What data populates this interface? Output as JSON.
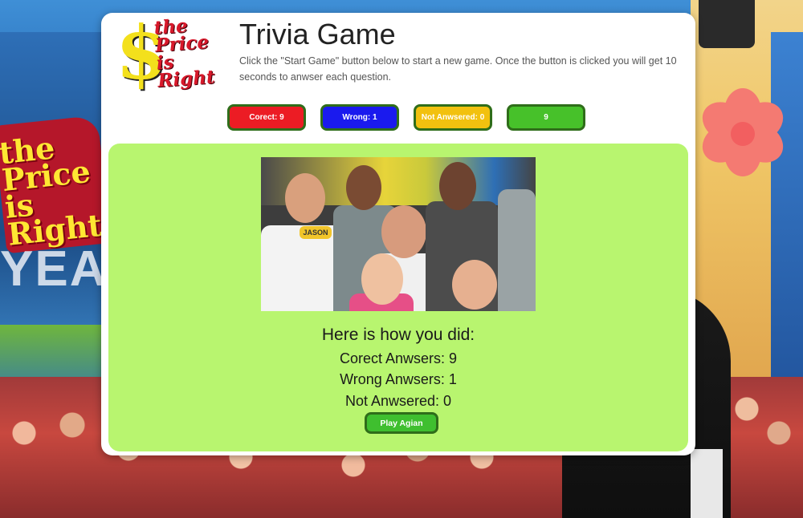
{
  "background": {
    "logo_text": [
      "the",
      "Price",
      "is",
      "Right"
    ],
    "year_text": "YEA"
  },
  "header": {
    "logo": {
      "symbol": "$",
      "words": [
        "the",
        "Price",
        "is",
        "Right"
      ]
    },
    "title": "Trivia Game",
    "description": "Click the \"Start Game\" button below to start a new game. Once the button is clicked you will get 10 seconds to anwser each question."
  },
  "stats": [
    {
      "label": "Corect: 9",
      "color": "#ec1c24"
    },
    {
      "label": "Wrong: 1",
      "color": "#1a1aee"
    },
    {
      "label": "Not Anwsered: 0",
      "color": "#f2c10f"
    },
    {
      "label": "9",
      "color": "#47c12a"
    }
  ],
  "result": {
    "heading": "Here is how you did:",
    "correct": "Corect Anwsers: 9",
    "wrong": "Wrong Anwsers: 1",
    "unanswered": "Not Anwsered: 0",
    "play_again_label": "Play Agian"
  },
  "photo": {
    "badge_text": "JASON"
  },
  "colors": {
    "panel_bg": "#b8f56f",
    "button_border": "#2f6d1a",
    "play_button": "#3fbf2f"
  }
}
